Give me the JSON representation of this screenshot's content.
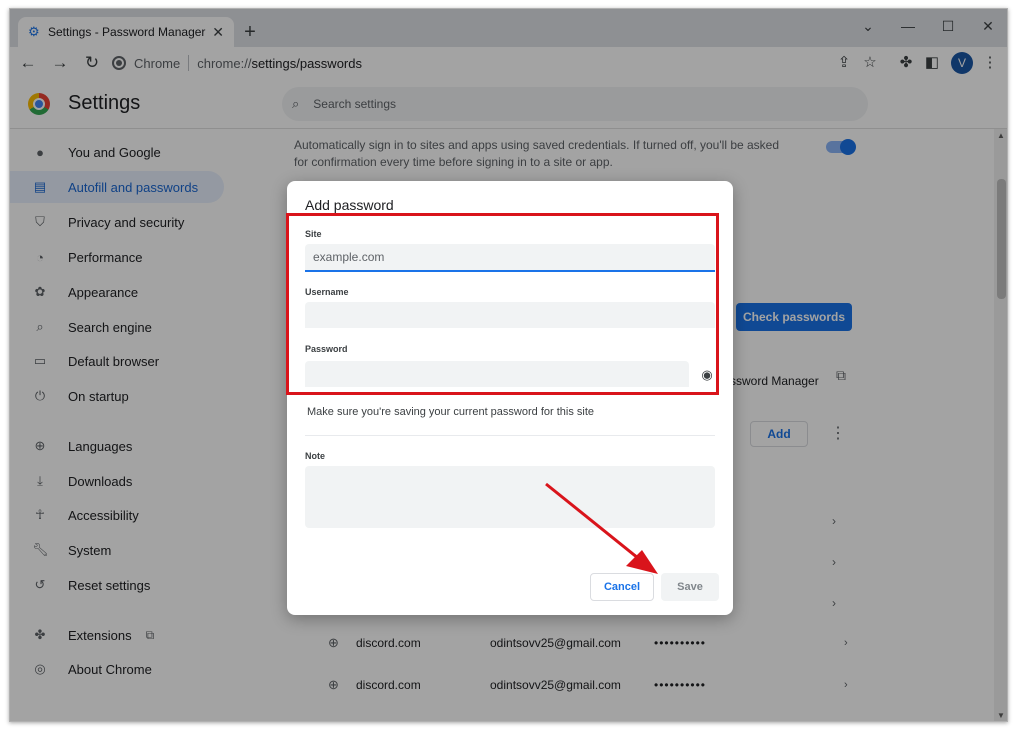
{
  "browser": {
    "tab_title": "Settings - Password Manager",
    "new_tab_symbol": "+",
    "omnibox": {
      "scheme_label": "Chrome",
      "url_host": "chrome://",
      "url_path": "settings/passwords"
    },
    "avatar_letter": "V",
    "window_controls": [
      "minimize",
      "maximize",
      "close"
    ]
  },
  "settings": {
    "title": "Settings",
    "search_placeholder": "Search settings",
    "sidebar": [
      {
        "label": "You and Google",
        "icon": "person-icon",
        "active": false
      },
      {
        "label": "Autofill and passwords",
        "icon": "clipboard-icon",
        "active": true
      },
      {
        "label": "Privacy and security",
        "icon": "shield-icon",
        "active": false
      },
      {
        "label": "Performance",
        "icon": "speedometer-icon",
        "active": false
      },
      {
        "label": "Appearance",
        "icon": "palette-icon",
        "active": false
      },
      {
        "label": "Search engine",
        "icon": "search-icon",
        "active": false
      },
      {
        "label": "Default browser",
        "icon": "browser-window-icon",
        "active": false
      },
      {
        "label": "On startup",
        "icon": "power-icon",
        "active": false
      },
      {
        "label": "Languages",
        "icon": "globe-icon",
        "active": false
      },
      {
        "label": "Downloads",
        "icon": "download-icon",
        "active": false
      },
      {
        "label": "Accessibility",
        "icon": "accessibility-icon",
        "active": false
      },
      {
        "label": "System",
        "icon": "wrench-icon",
        "active": false
      },
      {
        "label": "Reset settings",
        "icon": "reset-icon",
        "active": false
      },
      {
        "label": "Extensions",
        "icon": "puzzle-icon",
        "active": false
      },
      {
        "label": "About Chrome",
        "icon": "chrome-icon",
        "active": false
      }
    ],
    "content": {
      "auto_signin_text": "Automatically sign in to sites and apps using saved credentials. If turned off, you'll be asked for confirmation every time before signing in to a site or app.",
      "auto_signin_enabled": true,
      "check_passwords_label": "Check passwords",
      "password_manager_text": "ssword Manager",
      "add_label": "Add",
      "saved_passwords": [
        {
          "site": "discord.com",
          "username": "odintsovv25@gmail.com",
          "password_mask": "••••••••••"
        },
        {
          "site": "discord.com",
          "username": "odintsovv25@gmail.com",
          "password_mask": "••••••••••"
        }
      ]
    }
  },
  "dialog": {
    "title": "Add password",
    "site_label": "Site",
    "site_placeholder": "example.com",
    "site_value": "",
    "username_label": "Username",
    "username_value": "",
    "password_label": "Password",
    "password_value": "",
    "hint": "Make sure you're saving your current password for this site",
    "note_label": "Note",
    "note_value": "",
    "cancel_label": "Cancel",
    "save_label": "Save"
  },
  "colors": {
    "accent": "#1a73e8",
    "annotation": "#d9141b",
    "active_nav_bg": "#e8f0fe"
  }
}
